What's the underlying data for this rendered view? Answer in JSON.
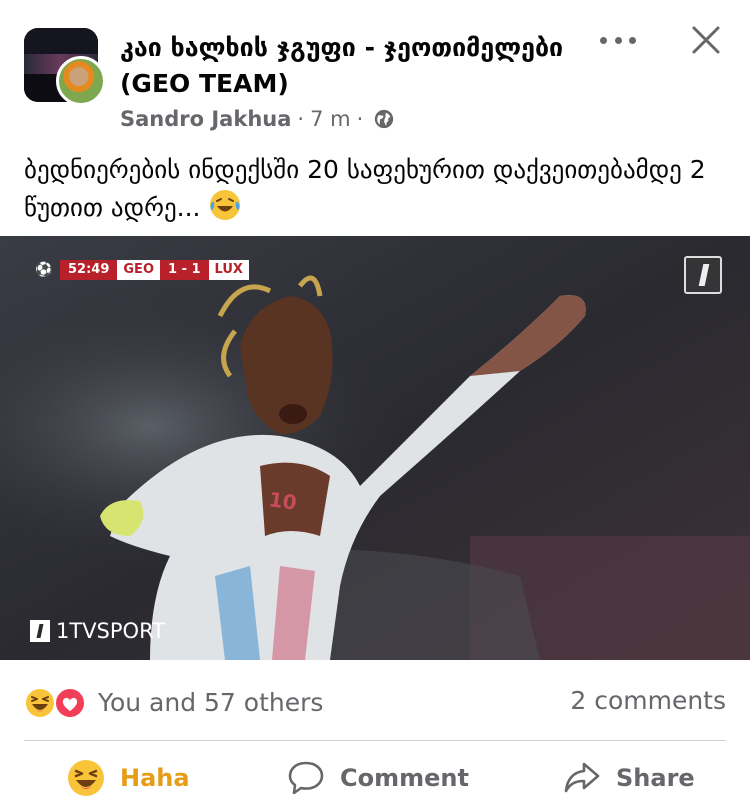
{
  "post": {
    "group_name": "კაი ხალხის ჯგუფი - ჯეოთიმელები (GEO TEAM)",
    "author": "Sandro Jakhua",
    "separator": "·",
    "time": "7 m",
    "body_text": "ბედნიერების ინდექსში 20 საფეხურით დაქვეითებამდე 2 წუთით ადრე...",
    "body_emoji": "laughing-tears-emoji"
  },
  "media": {
    "scorebug": {
      "clock": "52:49",
      "home_team": "GEO",
      "score": "1 - 1",
      "away_team": "LUX"
    },
    "watermark": "1TVSPORT"
  },
  "engagement": {
    "reaction_icons": [
      "haha",
      "love"
    ],
    "reactions_text": "You and 57 others",
    "comments_text": "2 comments"
  },
  "actions": {
    "haha_label": "Haha",
    "comment_label": "Comment",
    "share_label": "Share"
  },
  "colors": {
    "haha_active": "#e69c16",
    "secondary_text": "#65676b",
    "scorebug_red": "#b8202a"
  }
}
